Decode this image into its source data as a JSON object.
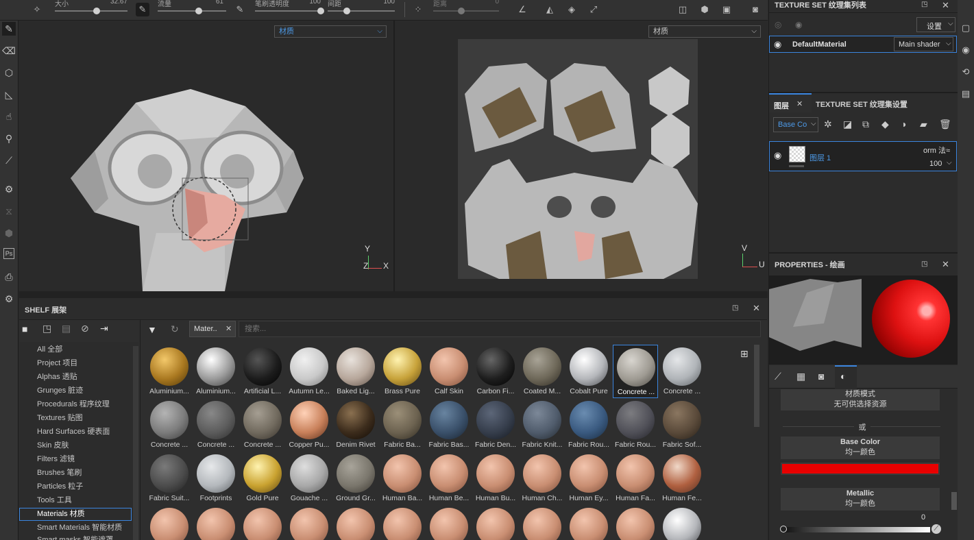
{
  "toolbar": {
    "size_label": "大小",
    "size_value": "32.67",
    "flow_label": "流量",
    "flow_value": "61",
    "opacity_label": "笔刷透明度",
    "opacity_value": "100",
    "spacing_label": "间距",
    "spacing_value": "100",
    "distance_label": "距离",
    "distance_value": "0"
  },
  "viewport3d": {
    "material_dropdown": "材质",
    "axis_y": "Y",
    "axis_x": "X",
    "axis_z": "Z"
  },
  "viewport2d": {
    "material_dropdown": "材质",
    "axis_v": "V",
    "axis_u": "U"
  },
  "texture_set_list": {
    "title": "TEXTURE SET 纹理集列表",
    "settings_label": "设置",
    "material_name": "DefaultMaterial",
    "shader": "Main shader"
  },
  "layers": {
    "tab_layers": "图层",
    "tab_settings": "TEXTURE SET 纹理集设置",
    "channel": "Base Co",
    "layer_name": "图层 1",
    "blend": "orm 法≈",
    "opacity": "100"
  },
  "properties": {
    "title": "PROPERTIES - 绘画",
    "material_mode": "材质模式",
    "no_resource": "无可供选择资源",
    "or": "或",
    "base_color_title": "Base Color",
    "base_color_sub": "均一颜色",
    "base_color_value": "#e80000",
    "metallic_title": "Metallic",
    "metallic_sub": "均一颜色",
    "metallic_value": "0"
  },
  "shelf": {
    "title": "SHELF 展架",
    "filter_tag": "Mater..",
    "search_placeholder": "搜索...",
    "categories": [
      "All 全部",
      "Project 项目",
      "Alphas 透贴",
      "Grunges 脏迹",
      "Procedurals 程序纹理",
      "Textures 贴图",
      "Hard Surfaces 硬表面",
      "Skin 皮肤",
      "Filters 滤镜",
      "Brushes 笔刷",
      "Particles 粒子",
      "Tools 工具",
      "Materials 材质",
      "Smart Materials 智能材质",
      "Smart masks 智能遮罩"
    ],
    "selected_category": "Materials 材质",
    "materials": [
      [
        "Aluminium...",
        "Aluminium...",
        "Artificial L...",
        "Autumn Le...",
        "Baked Lig...",
        "Brass Pure",
        "Calf Skin",
        "Carbon Fi...",
        "Coated M...",
        "Cobalt Pure",
        "Concrete ...",
        "Concrete ..."
      ],
      [
        "Concrete ...",
        "Concrete ...",
        "Concrete ...",
        "Copper Pu...",
        "Denim Rivet",
        "Fabric Ba...",
        "Fabric Bas...",
        "Fabric Den...",
        "Fabric Knit...",
        "Fabric Rou...",
        "Fabric Rou...",
        "Fabric Sof..."
      ],
      [
        "Fabric Suit...",
        "Footprints",
        "Gold Pure",
        "Gouache ...",
        "Ground Gr...",
        "Human Ba...",
        "Human Be...",
        "Human Bu...",
        "Human Ch...",
        "Human Ey...",
        "Human Fa...",
        "Human Fe..."
      ],
      [
        "",
        "",
        "",
        "",
        "",
        "",
        "",
        "",
        "",
        "",
        "",
        ""
      ]
    ],
    "selected_material": "Concrete ..."
  }
}
